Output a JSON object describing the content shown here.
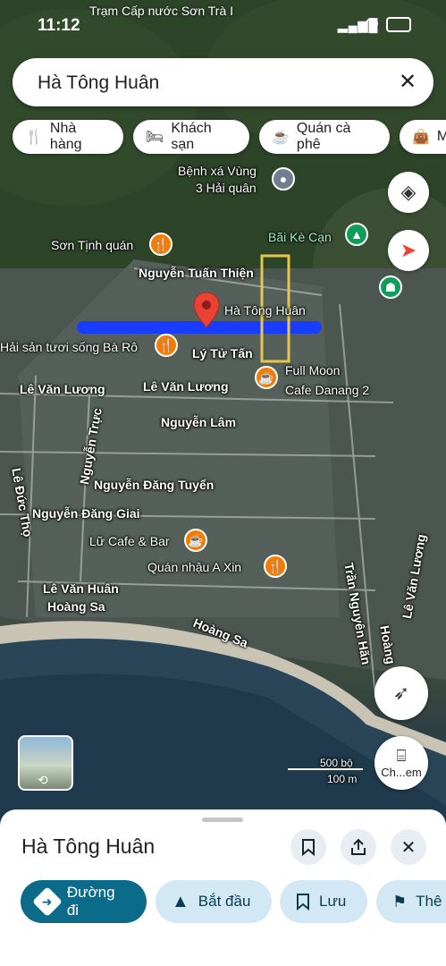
{
  "status_bar": {
    "time": "11:12",
    "location_title": "Trạm Cấp nước Sơn Trà I"
  },
  "search": {
    "query": "Hà Tông Huân"
  },
  "chips": [
    {
      "label": "Nhà hàng",
      "icon": "restaurant-icon"
    },
    {
      "label": "Khách sạn",
      "icon": "hotel-icon"
    },
    {
      "label": "Quán cà phê",
      "icon": "coffee-icon"
    },
    {
      "label": "M",
      "icon": "shopping-icon"
    }
  ],
  "map": {
    "places": {
      "benh_xa_line1": "Bệnh xá Vùng",
      "benh_xa_line2": "3 Hải quân",
      "bai_ke_can": "Bãi Kè Cạn",
      "son_tinh_quan": "Sơn Tịnh quán",
      "hai_san": "Hải sản tươi sống Bà Rô",
      "full_moon_line1": "Full Moon",
      "full_moon_line2": "Cafe Danang 2",
      "lu_cafe": "Lữ Cafe & Bar",
      "quan_nhau": "Quán nhậu A Xin",
      "pin_label": "Hà Tông Huân"
    },
    "streets": {
      "nguyen_tuan_thien": "Nguyễn Tuấn Thiện",
      "ly_tu_tan": "Lý Tử Tấn",
      "le_van_luong_1": "Lê Văn Lương",
      "le_van_luong_2": "Lê Văn Lương",
      "nguyen_lam": "Nguyễn Lâm",
      "nguyen_truc": "Nguyễn Trực",
      "nguyen_dang_tuyen": "Nguyễn Đăng Tuyển",
      "nguyen_dang_giai": "Nguyễn Đăng Giai",
      "le_duc_tho": "Lê Đức Thọ",
      "le_van_huan": "Lê Văn Huân",
      "hoang_sa_1": "Hoàng Sa",
      "hoang_sa_2": "Hoàng Sa",
      "tran_nguyen_han": "Trần Nguyên Hãn",
      "le_van_luong_right": "Lê Văn Lương",
      "huan_vertical": "Hoàng"
    },
    "scale": {
      "top": "500 bộ",
      "bottom": "100 m"
    },
    "street_view_icon": "street-view-icon",
    "explore_label": "Ch...em"
  },
  "sheet": {
    "title": "Hà Tông Huân",
    "actions": [
      {
        "label": "Đường đi",
        "icon": "directions-icon"
      },
      {
        "label": "Bắt đầu",
        "icon": "navigation-arrow-icon"
      },
      {
        "label": "Lưu",
        "icon": "bookmark-icon"
      },
      {
        "label": "Thê",
        "icon": "flag-icon"
      }
    ]
  },
  "colors": {
    "accent": "#0b57d0",
    "directions_bg": "#0b6b8a",
    "action_bg": "#d3e8f5",
    "pin": "#ea4335",
    "poi_orange": "#f57c00",
    "highlight_line": "#1a3cff",
    "highlight_box": "#e8c64a"
  }
}
